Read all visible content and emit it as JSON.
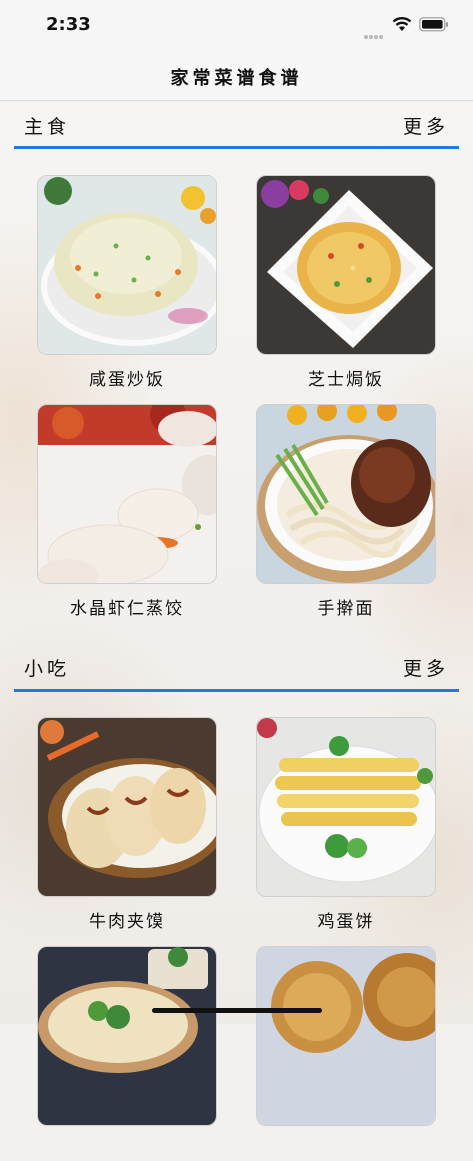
{
  "status_bar": {
    "time": "2:33"
  },
  "nav": {
    "title": "家常菜谱食谱"
  },
  "sections": [
    {
      "title": "主食",
      "more_label": "更多",
      "items": [
        {
          "name": "咸蛋炒饭",
          "photo": "fried-rice-photo"
        },
        {
          "name": "芝士焗饭",
          "photo": "cheese-baked-rice-photo"
        },
        {
          "name": "水晶虾仁蒸饺",
          "photo": "shrimp-dumplings-photo"
        },
        {
          "name": "手擀面",
          "photo": "hand-rolled-noodles-photo"
        }
      ]
    },
    {
      "title": "小吃",
      "more_label": "更多",
      "items": [
        {
          "name": "牛肉夹馍",
          "photo": "beef-bun-photo"
        },
        {
          "name": "鸡蛋饼",
          "photo": "egg-pancake-photo"
        },
        {
          "name": "",
          "photo": "noodle-bowl-photo"
        },
        {
          "name": "",
          "photo": "pastry-photo"
        }
      ]
    }
  ],
  "colors": {
    "accent": "#1e78e6",
    "nav_bg": "#f7f7f7",
    "text": "#111111"
  }
}
